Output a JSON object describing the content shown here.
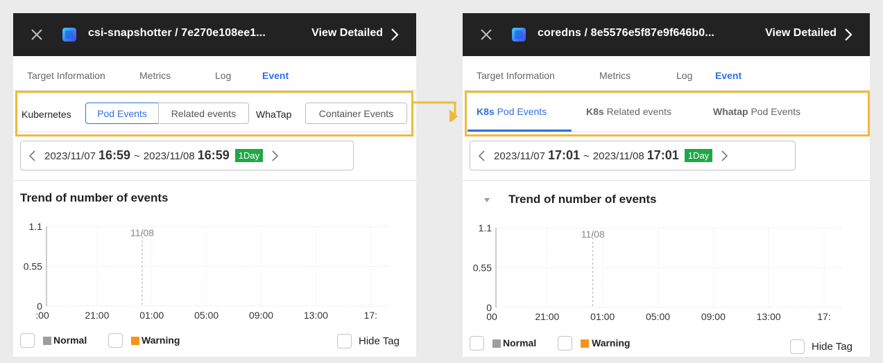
{
  "left": {
    "header": {
      "title": "csi-snapshotter / 7e270e108ee1...",
      "detail": "View Detailed",
      "close_icon": "close-icon",
      "app_icon": "cube-icon"
    },
    "tabs": [
      "Target Information",
      "Metrics",
      "Log",
      "Event"
    ],
    "active_tab": "Event",
    "subtabs": {
      "kubernetes_label": "Kubernetes",
      "pod_events": "Pod Events",
      "related_events": "Related events",
      "whatap_label": "WhaTap",
      "container_events": "Container Events"
    },
    "date": {
      "start_date": "2023/11/07",
      "start_time": "16:59",
      "sep": "~",
      "end_date": "2023/11/08",
      "end_time": "16:59",
      "range": "1Day"
    },
    "chart_title": "Trend of number of events",
    "legend": {
      "normal": "Normal",
      "warning": "Warning",
      "hide_tag": "Hide Tag"
    }
  },
  "right": {
    "header": {
      "title": "coredns / 8e5576e5f87e9f646b0...",
      "detail": "View Detailed",
      "close_icon": "close-icon",
      "app_icon": "cube-icon"
    },
    "tabs": [
      "Target Information",
      "Metrics",
      "Log",
      "Event"
    ],
    "active_tab": "Event",
    "subtabs": [
      {
        "prefix": "K8s",
        "label": "Pod Events"
      },
      {
        "prefix": "K8s",
        "label": "Related events"
      },
      {
        "prefix": "Whatap",
        "label": "Pod Events"
      }
    ],
    "date": {
      "start_date": "2023/11/07",
      "start_time": "17:01",
      "sep": "~",
      "end_date": "2023/11/08",
      "end_time": "17:01",
      "range": "1Day"
    },
    "chart_title": "Trend of number of events",
    "legend": {
      "normal": "Normal",
      "warning": "Warning",
      "hide_tag": "Hide Tag"
    }
  },
  "colors": {
    "header_bg": "#222222",
    "accent": "#2f6fe0",
    "badge": "#1ea845",
    "highlight": "#f0b93b",
    "normal": "#9e9e9e",
    "warning": "#f7941d"
  },
  "chart_data": [
    {
      "type": "line",
      "title": "Trend of number of events",
      "x_tick_labels": [
        ":00",
        "21:00",
        "01:00",
        "05:00",
        "09:00",
        "13:00",
        "17:"
      ],
      "y_tick_labels": [
        "1.1",
        "0.55",
        "0"
      ],
      "ylim": [
        0,
        1.1
      ],
      "annotation": "11/08",
      "series": [
        {
          "name": "Normal",
          "values": []
        },
        {
          "name": "Warning",
          "values": []
        }
      ],
      "grid": true
    },
    {
      "type": "line",
      "title": "Trend of number of events",
      "x_tick_labels": [
        "00",
        "21:00",
        "01:00",
        "05:00",
        "09:00",
        "13:00",
        "17:"
      ],
      "y_tick_labels": [
        "1.1",
        "0.55",
        "0"
      ],
      "ylim": [
        0,
        1.1
      ],
      "annotation": "11/08",
      "series": [
        {
          "name": "Normal",
          "values": []
        },
        {
          "name": "Warning",
          "values": []
        }
      ],
      "grid": true
    }
  ]
}
